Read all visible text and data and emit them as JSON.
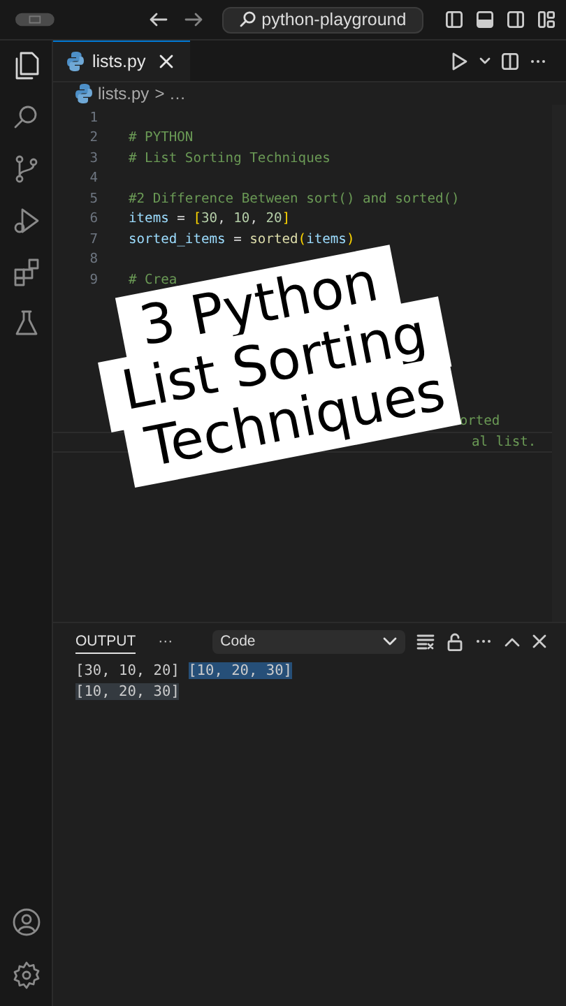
{
  "titlebar": {
    "search": "python-playground"
  },
  "tabs": [
    {
      "label": "lists.py",
      "selected": true
    }
  ],
  "breadcrumb": {
    "file": "lists.py",
    "rest": "> …"
  },
  "activity_bar": [
    {
      "selected": true
    },
    {
      "selected": false
    },
    {
      "selected": false
    },
    {
      "selected": false
    },
    {
      "selected": false
    },
    {
      "selected": false
    }
  ],
  "editor_lines": [
    {
      "kind": "code",
      "number": "1"
    },
    {
      "kind": "code",
      "number": "2",
      "tokens": [
        {
          "text": "# PYTHON",
          "kind": "comment"
        }
      ]
    },
    {
      "kind": "code",
      "number": "3",
      "tokens": [
        {
          "text": "# List Sorting Techniques",
          "kind": "comment"
        }
      ]
    },
    {
      "kind": "code",
      "number": "4"
    },
    {
      "kind": "code",
      "number": "5",
      "tokens": [
        {
          "text": "#2 Difference Between sort() and sorted()",
          "kind": "comment"
        }
      ]
    },
    {
      "kind": "code",
      "number": "6",
      "tokens": [
        {
          "text": "items",
          "kind": "var"
        },
        {
          "text": " = ",
          "kind": "op"
        },
        {
          "text": "[",
          "kind": "bracket"
        },
        {
          "text": "30",
          "kind": "num"
        },
        {
          "text": ", ",
          "kind": "op"
        },
        {
          "text": "10",
          "kind": "num"
        },
        {
          "text": ", ",
          "kind": "op"
        },
        {
          "text": "20",
          "kind": "num"
        },
        {
          "text": "]",
          "kind": "bracket"
        }
      ]
    },
    {
      "kind": "code",
      "number": "7",
      "tokens": [
        {
          "text": "sorted_items",
          "kind": "var"
        },
        {
          "text": " = ",
          "kind": "op"
        },
        {
          "text": "sorted",
          "kind": "func"
        },
        {
          "text": "(",
          "kind": "bracket"
        },
        {
          "text": "items",
          "kind": "var"
        },
        {
          "text": ")",
          "kind": "bracket"
        }
      ]
    },
    {
      "kind": "code",
      "number": "8"
    },
    {
      "kind": "code",
      "number": "9",
      "tokens": [
        {
          "text": "# Crea",
          "kind": "comment"
        }
      ]
    },
    {
      "kind": "fragment",
      "tokens": [
        {
          "text": "orted",
          "kind": "comment"
        }
      ]
    },
    {
      "kind": "fragment",
      "current": true,
      "tokens": [
        {
          "text": "al list.",
          "kind": "comment"
        }
      ]
    }
  ],
  "overlay_caption": [
    "3 Python",
    "List Sorting",
    "Techniques"
  ],
  "panel": {
    "tab": "OUTPUT",
    "more": "···",
    "dropdown": "Code",
    "lines": [
      [
        {
          "text": "[30, 10, 20] ",
          "kind": "plain"
        },
        {
          "text": "[10, 20, 30]",
          "kind": "selection"
        }
      ],
      [
        {
          "text": "[10, 20, 30]",
          "kind": "match"
        }
      ]
    ]
  }
}
